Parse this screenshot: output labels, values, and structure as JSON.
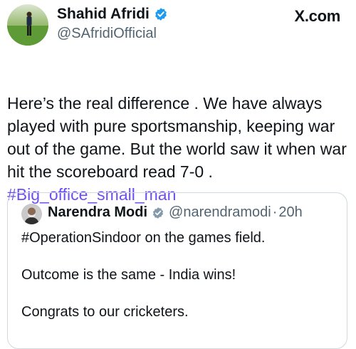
{
  "author": {
    "name": "Shahid Afridi",
    "handle": "@SAfridiOfficial",
    "verified_icon": "verified-badge-icon"
  },
  "brand": {
    "label": "X.com"
  },
  "tweet": {
    "text": "Here’s the real difference . We have always\nplayed with pure sportsmanship, keeping war\nout of the game. But the world saw it when war\nhit the scoreboard read 7-0 .",
    "hashtag": "#Big_office_small_man",
    "hashtag_color": "#6d4ef1"
  },
  "quote": {
    "name": "Narendra Modi",
    "handle": "@narendramodi",
    "separator": "·",
    "time": "20h",
    "lines": [
      "#OperationSindoor on the games field.",
      "Outcome is the same - India wins!",
      "Congrats to our cricketers."
    ]
  },
  "colors": {
    "verified": "#1d9bf0",
    "secondary_text": "#536471",
    "border": "#cfd9de"
  }
}
